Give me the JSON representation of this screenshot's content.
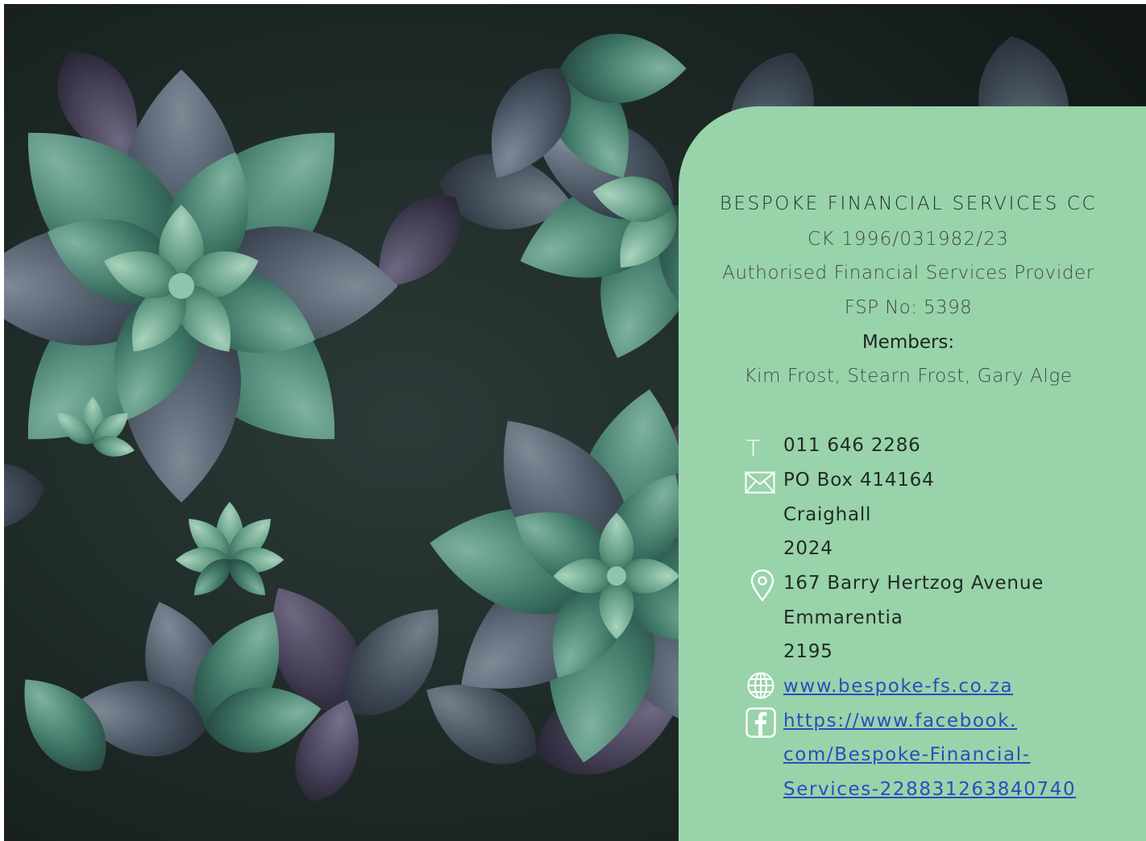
{
  "company": {
    "name": "BESPOKE FINANCIAL SERVICES CC",
    "registration": "CK 1996/031982/23",
    "description": "Authorised Financial Services Provider",
    "fsp_number": "FSP No: 5398"
  },
  "members": {
    "heading": "Members:",
    "names": "Kim Frost, Stearn Frost, Gary Alge"
  },
  "contact": {
    "phone_glyph": "T",
    "phone": "011 646 2286",
    "postal": [
      "PO Box 414164",
      "Craighall",
      "2024"
    ],
    "physical": [
      "167 Barry Hertzog Avenue",
      "Emmarentia",
      "2195"
    ],
    "website": "www.bespoke-fs.co.za",
    "facebook_lines": [
      "https://www.facebook.",
      "com/Bespoke-Financial-",
      "Services-228831263840740"
    ]
  },
  "icons": {
    "phone": "phone-icon",
    "postal": "mail-envelope-icon",
    "physical": "location-pin-icon",
    "website": "globe-icon",
    "facebook": "facebook-icon"
  },
  "colors": {
    "panel": "#99d3aa",
    "link": "#2a4dbd",
    "icon": "#ffffff"
  }
}
